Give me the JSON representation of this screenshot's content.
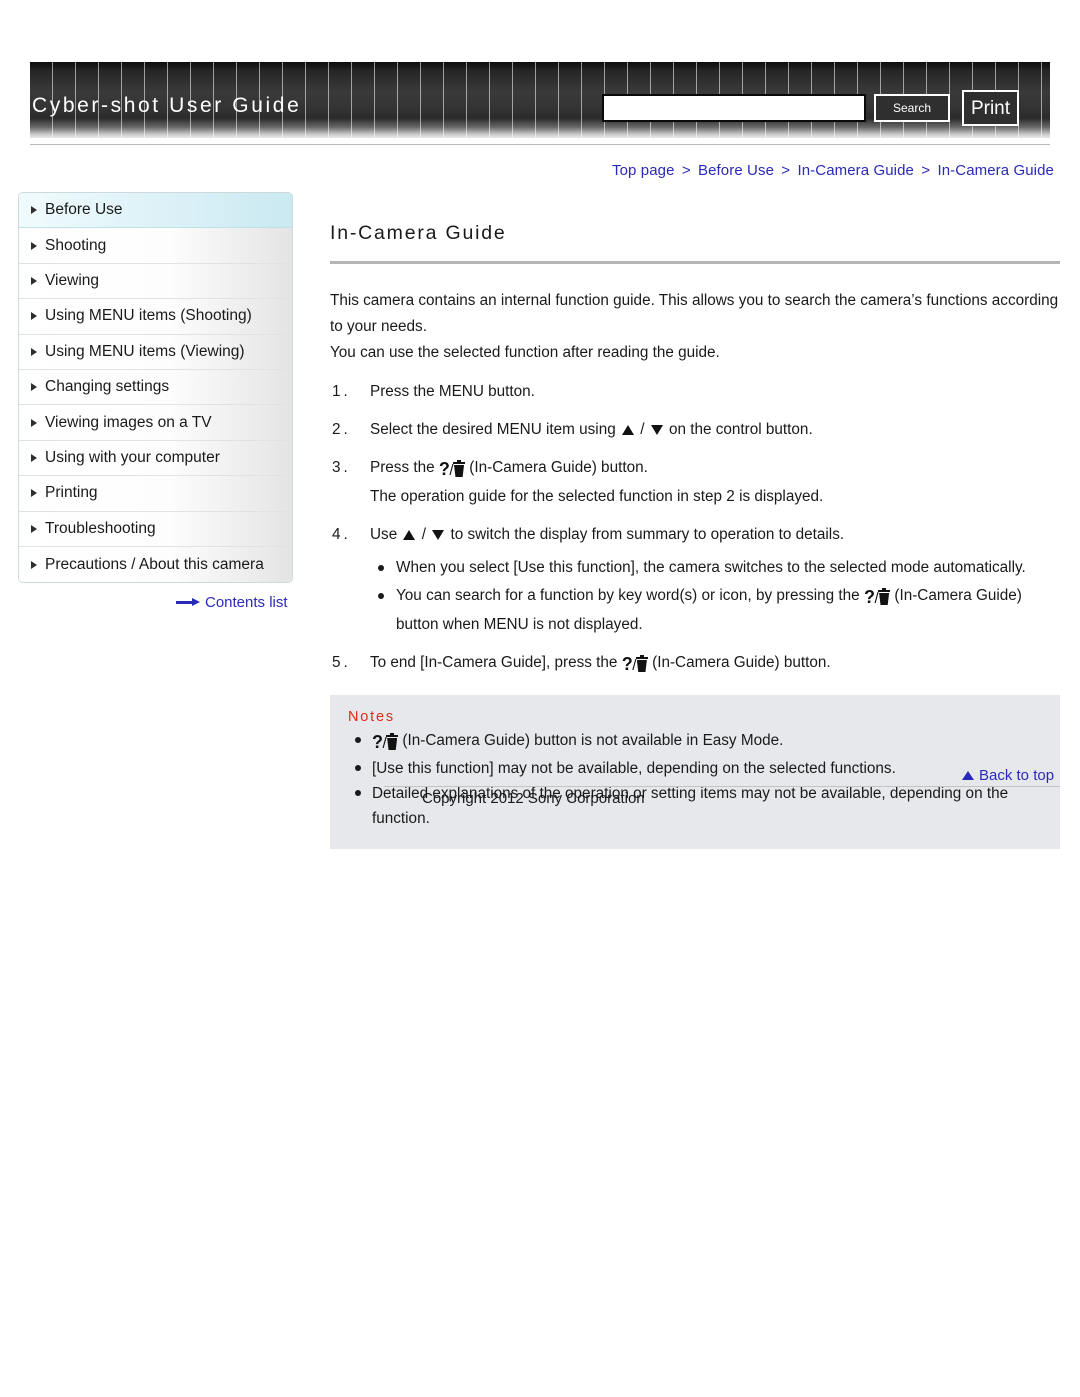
{
  "header": {
    "site_title": "Cyber-shot User Guide",
    "search_value": "",
    "search_placeholder": "",
    "search_button": "Search",
    "print_button": "Print"
  },
  "breadcrumb": {
    "items": [
      "Top page",
      "Before Use",
      "In-Camera Guide",
      "In-Camera Guide"
    ],
    "separator": ">"
  },
  "sidebar": {
    "items": [
      {
        "label": "Before Use",
        "active": true
      },
      {
        "label": "Shooting",
        "active": false
      },
      {
        "label": "Viewing",
        "active": false
      },
      {
        "label": "Using MENU items (Shooting)",
        "active": false
      },
      {
        "label": "Using MENU items (Viewing)",
        "active": false
      },
      {
        "label": "Changing settings",
        "active": false
      },
      {
        "label": "Viewing images on a TV",
        "active": false
      },
      {
        "label": "Using with your computer",
        "active": false
      },
      {
        "label": "Printing",
        "active": false
      },
      {
        "label": "Troubleshooting",
        "active": false
      },
      {
        "label": "Precautions / About this camera",
        "active": false
      }
    ],
    "contents_link": "Contents list"
  },
  "main": {
    "title": "In-Camera Guide",
    "intro_line_1": "This camera contains an internal function guide. This allows you to search the camera’s functions according to your needs.",
    "intro_line_2": "You can use the selected function after reading the guide.",
    "steps": [
      {
        "number": "1.",
        "text_before": "Press the MENU button.",
        "text_middle": "",
        "text_after": "",
        "sub": ""
      },
      {
        "number": "2.",
        "text_before": "Select the desired MENU item using",
        "text_middle": "/",
        "text_after": "on the control button.",
        "sub": ""
      },
      {
        "number": "3.",
        "text_before": "Press the",
        "text_after": "(In-Camera Guide) button.",
        "sub": "The operation guide for the selected function in step 2 is displayed."
      },
      {
        "number": "4.",
        "text_before": "Use",
        "text_middle": "/",
        "text_after": "to switch the display from summary to operation to details.",
        "bullets": [
          {
            "before": "When you select [Use this function], the camera switches to the selected mode automatically.",
            "after": ""
          },
          {
            "before": "You can search for a function by key word(s) or icon, by pressing the",
            "after": "(In-Camera Guide) button when MENU is not displayed."
          }
        ]
      },
      {
        "number": "5.",
        "text_before": "To end [In-Camera Guide], press the",
        "text_after": "(In-Camera Guide) button.",
        "sub": ""
      }
    ],
    "notes": {
      "title": "Notes",
      "items": [
        {
          "before": "",
          "after": "(In-Camera Guide) button is not available in Easy Mode.",
          "has_icon": true
        },
        {
          "before": "[Use this function] may not be available, depending on the selected functions.",
          "after": "",
          "has_icon": false
        },
        {
          "before": "Detailed explanations of the operation or setting items may not be available, depending on the function.",
          "after": "",
          "has_icon": false
        }
      ]
    }
  },
  "footer": {
    "back_to_top": "Back to top",
    "copyright": "Copyright 2012 Sony Corporation"
  },
  "icons": {
    "guide_button": "question-trash-icon",
    "up": "triangle-up-icon",
    "down": "triangle-down-icon",
    "arrow_right": "arrow-right-icon"
  },
  "colors": {
    "link": "#2a2ab8",
    "notes_title": "#e0281e",
    "notes_bg": "#e6e8ec",
    "active_nav": "#d3edf4"
  }
}
